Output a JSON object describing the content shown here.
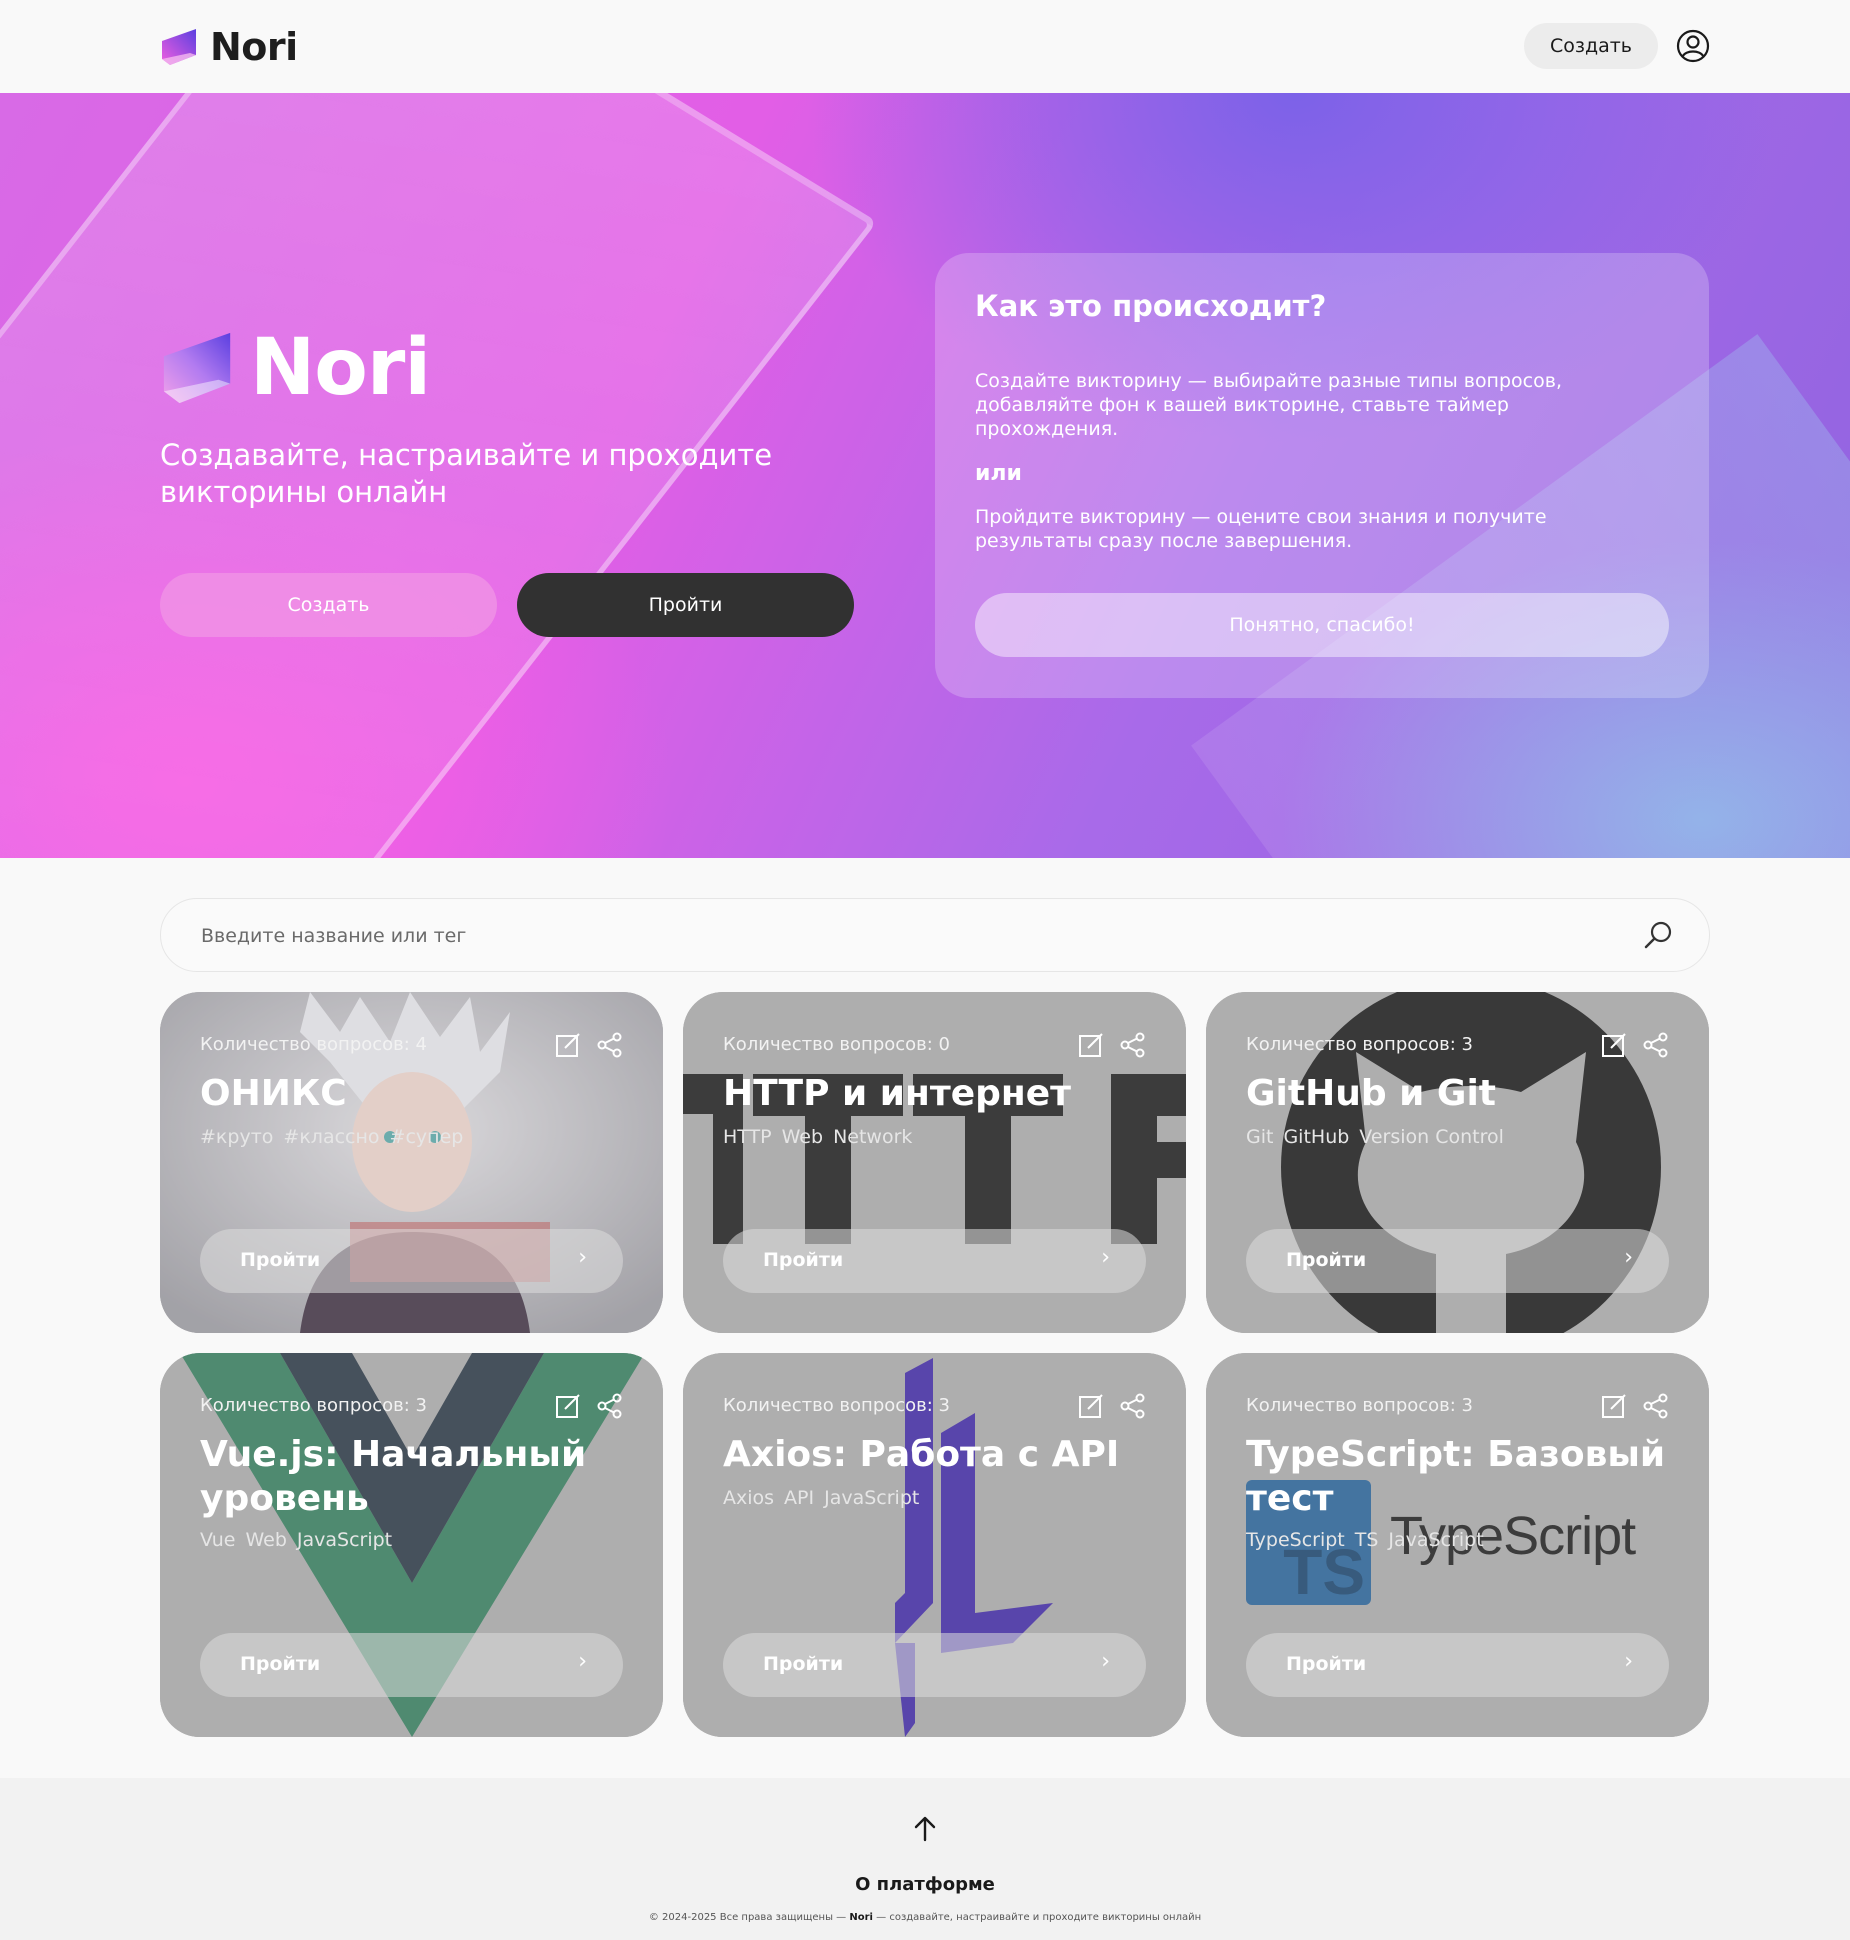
{
  "header": {
    "brand": "Nori",
    "create_label": "Создать"
  },
  "hero": {
    "brand": "Nori",
    "subtitle": "Создавайте, настраивайте и проходите викторины онлайн",
    "create_label": "Создать",
    "go_label": "Пройти"
  },
  "info": {
    "title": "Как это происходит?",
    "p1": "Создайте викторину — выбирайте разные типы вопросов, добавляйте фон к вашей викторине, ставьте таймер прохождения.",
    "or": "или",
    "p2": "Пройдите викторину — оцените свои знания и получите результаты сразу после завершения.",
    "button": "Понятно, спасибо!"
  },
  "search": {
    "placeholder": "Введите название или тег"
  },
  "cards": [
    {
      "count": "Количество вопросов: 4",
      "title": "ОНИКС",
      "tags": [
        "#круто",
        "#классно",
        "#супер"
      ],
      "button": "Пройти",
      "image": "anime-character"
    },
    {
      "count": "Количество вопросов: 0",
      "title": "HTTP и интернет",
      "tags": [
        "HTTP",
        "Web",
        "Network"
      ],
      "button": "Пройти",
      "image": "http-text"
    },
    {
      "count": "Количество вопросов: 3",
      "title": "GitHub и Git",
      "tags": [
        "Git",
        "GitHub",
        "Version Control"
      ],
      "button": "Пройти",
      "image": "github-octocat"
    },
    {
      "count": "Количество вопросов: 3",
      "title": "Vue.js: Начальный уровень",
      "tags": [
        "Vue",
        "Web",
        "JavaScript"
      ],
      "button": "Пройти",
      "image": "vue-logo"
    },
    {
      "count": "Количество вопросов: 3",
      "title": "Axios: Работа с API",
      "tags": [
        "Axios",
        "API",
        "JavaScript"
      ],
      "button": "Пройти",
      "image": "axios-logo"
    },
    {
      "count": "Количество вопросов: 3",
      "title": "TypeScript: Базовый тест",
      "tags": [
        "TypeScript",
        "TS",
        "JavaScript"
      ],
      "button": "Пройти",
      "image": "typescript-logo",
      "logo_text": "TypeScript",
      "logo_badge": "TS"
    }
  ],
  "footer": {
    "about": "О платформе",
    "copyright_pre": "© 2024-2025 Все права защищены — ",
    "copyright_brand": "Nori",
    "copyright_post": " — создавайте, настраивайте и проходите викторины онлайн"
  },
  "colors": {
    "accent_dark": "#313131",
    "hero_pink": "#e25ee6",
    "hero_violet": "#8f63df"
  }
}
